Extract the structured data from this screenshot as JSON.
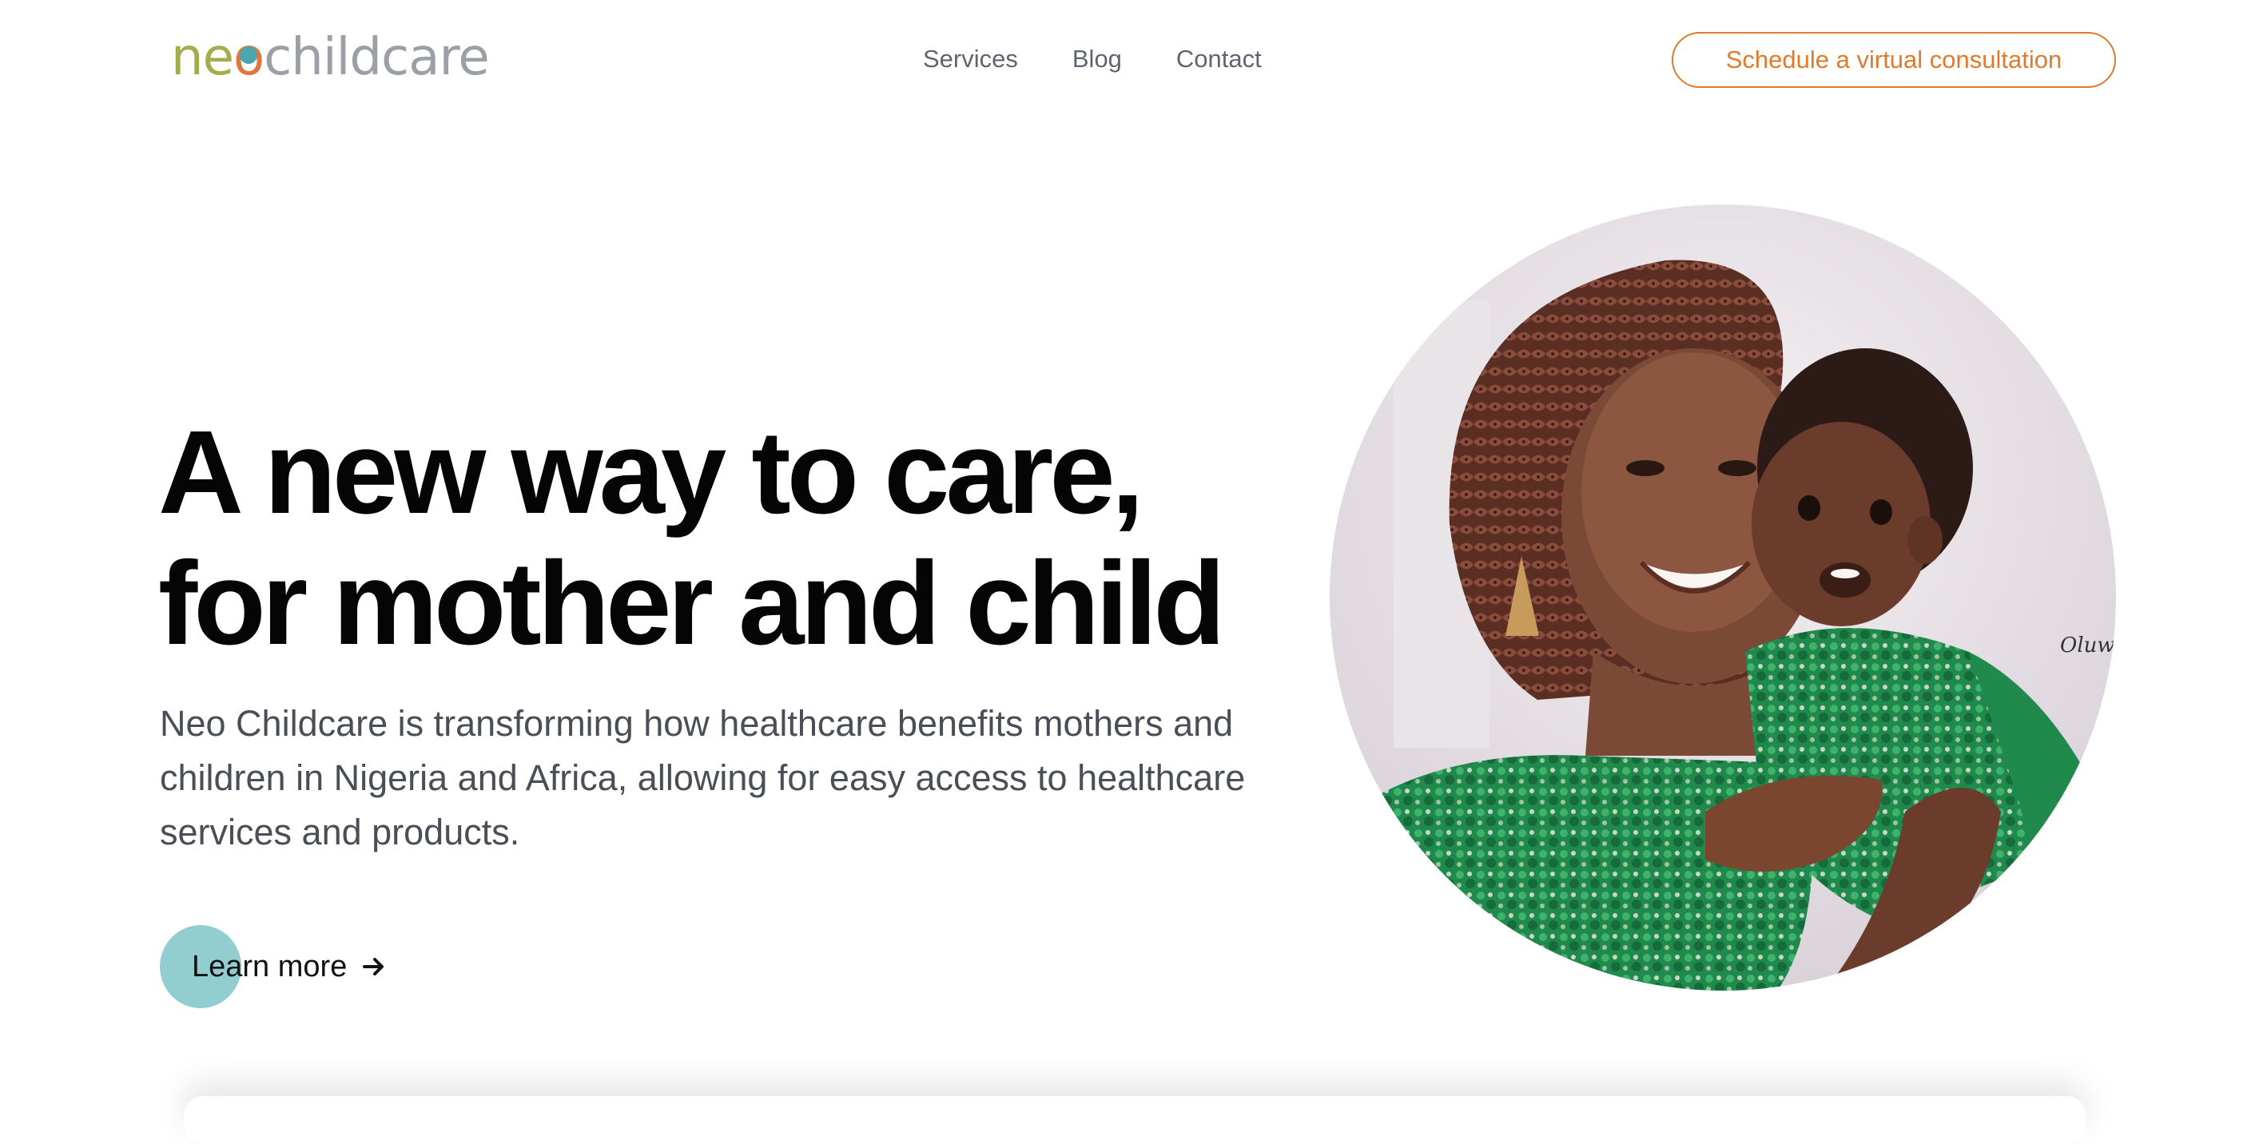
{
  "header": {
    "logo": {
      "part1": "ne",
      "part2": "o",
      "part3": "childcare"
    },
    "nav": [
      {
        "label": "Services"
      },
      {
        "label": "Blog"
      },
      {
        "label": "Contact"
      }
    ],
    "cta_label": "Schedule a virtual consultation"
  },
  "hero": {
    "headline_line1": "A new way to care,",
    "headline_line2": "for mother and child",
    "subtitle": "Neo Childcare is transforming how healthcare benefits mothers and children in Nigeria and Africa, allowing for easy access to healthcare services and products.",
    "learn_more_label": "Learn more",
    "photo_signature": "Oluwaseun"
  },
  "colors": {
    "accent_orange": "#e07a2c",
    "teal": "#92cdd0",
    "logo_olive": "#a3ad4b",
    "text_dark": "#050505",
    "text_muted": "#4a4f57"
  }
}
